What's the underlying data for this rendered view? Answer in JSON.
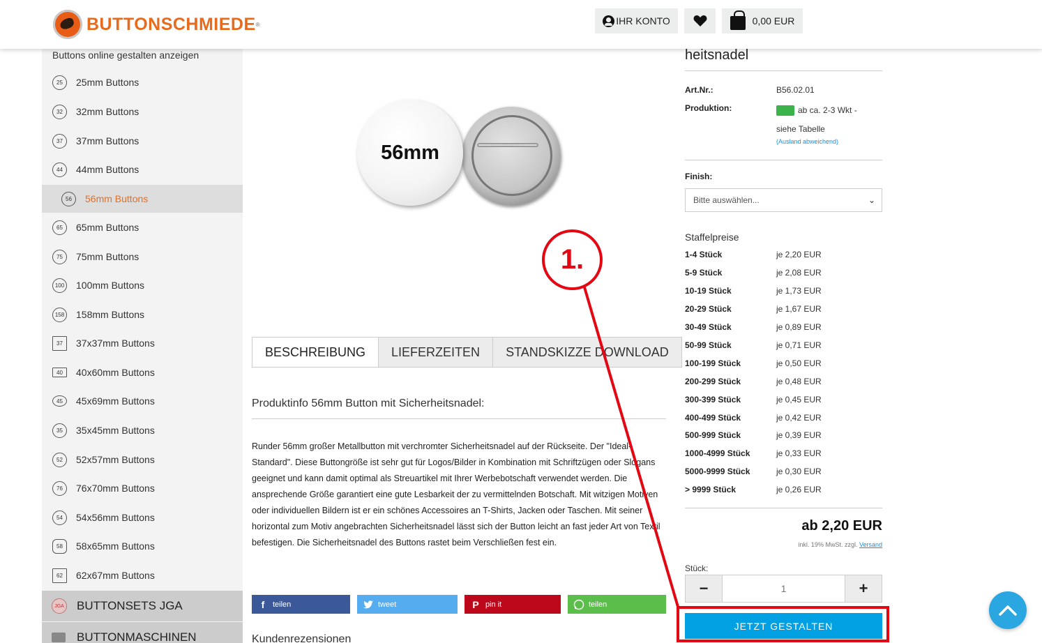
{
  "header": {
    "logo_text": "BUTTONSCHMIEDE",
    "account_label": "IHR KONTO",
    "cart_total": "0,00 EUR"
  },
  "sidebar": {
    "heading": "Buttons online gestalten anzeigen",
    "items": [
      {
        "badge": "25",
        "label": "25mm Buttons"
      },
      {
        "badge": "32",
        "label": "32mm Buttons"
      },
      {
        "badge": "37",
        "label": "37mm Buttons"
      },
      {
        "badge": "44",
        "label": "44mm Buttons"
      },
      {
        "badge": "56",
        "label": "56mm Buttons"
      },
      {
        "badge": "65",
        "label": "65mm Buttons"
      },
      {
        "badge": "75",
        "label": "75mm Buttons"
      },
      {
        "badge": "100",
        "label": "100mm Buttons"
      },
      {
        "badge": "158",
        "label": "158mm Buttons"
      },
      {
        "badge": "37",
        "label": "37x37mm Buttons"
      },
      {
        "badge": "40",
        "label": "40x60mm Buttons"
      },
      {
        "badge": "45",
        "label": "45x69mm Buttons"
      },
      {
        "badge": "35",
        "label": "35x45mm Buttons"
      },
      {
        "badge": "52",
        "label": "52x57mm Buttons"
      },
      {
        "badge": "76",
        "label": "76x70mm Buttons"
      },
      {
        "badge": "54",
        "label": "54x56mm Buttons"
      },
      {
        "badge": "58",
        "label": "58x65mm Buttons"
      },
      {
        "badge": "62",
        "label": "62x67mm Buttons"
      }
    ],
    "sets_label": "BUTTONSETS JGA",
    "sets_badge": "JGA",
    "machines_label": "BUTTONMASCHINEN"
  },
  "product": {
    "image_label": "56mm",
    "title_partial": "heitsnadel",
    "art_label": "Art.Nr.:",
    "art_value": "B56.02.01",
    "production_label": "Produktion:",
    "production_value": "ab ca. 2-3 Wkt -",
    "production_value2": "siehe Tabelle",
    "production_note": "(Ausland abweichend)",
    "finish_label": "Finish:",
    "finish_placeholder": "Bitte auswählen...",
    "staffel_heading": "Staffelpreise",
    "tiers": [
      {
        "qty": "1-4 Stück",
        "price": "je 2,20 EUR"
      },
      {
        "qty": "5-9 Stück",
        "price": "je 2,08 EUR"
      },
      {
        "qty": "10-19 Stück",
        "price": "je 1,73 EUR"
      },
      {
        "qty": "20-29 Stück",
        "price": "je 1,67 EUR"
      },
      {
        "qty": "30-49 Stück",
        "price": "je 0,89 EUR"
      },
      {
        "qty": "50-99 Stück",
        "price": "je 0,71 EUR"
      },
      {
        "qty": "100-199 Stück",
        "price": "je 0,50 EUR"
      },
      {
        "qty": "200-299 Stück",
        "price": "je 0,48 EUR"
      },
      {
        "qty": "300-399 Stück",
        "price": "je 0,45 EUR"
      },
      {
        "qty": "400-499 Stück",
        "price": "je 0,42 EUR"
      },
      {
        "qty": "500-999 Stück",
        "price": "je 0,39 EUR"
      },
      {
        "qty": "1000-4999 Stück",
        "price": "je 0,33 EUR"
      },
      {
        "qty": "5000-9999 Stück",
        "price": "je 0,30 EUR"
      },
      {
        "qty": "> 9999 Stück",
        "price": "je 0,26 EUR"
      }
    ],
    "price": "ab 2,20 EUR",
    "tax_note": "inkl. 19% MwSt. zzgl.",
    "shipping_link": "Versand",
    "qty_label": "Stück:",
    "qty_minus": "−",
    "qty_value": "1",
    "qty_plus": "+",
    "cta_label": "JETZT GESTALTEN"
  },
  "tabs": [
    "BESCHREIBUNG",
    "LIEFERZEITEN",
    "STANDSKIZZE DOWNLOAD"
  ],
  "description": {
    "heading": "Produktinfo 56mm Button mit Sicherheitsnadel:",
    "text": "Runder 56mm großer Metallbutton mit verchromter Sicherheitsnadel auf der Rückseite. Der \"Ideal-Standard\". Diese Buttongröße ist sehr gut für Logos/Bilder in Kombination mit Schriftzügen oder Slogans geeignet und kann damit optimal als Streuartikel mit Ihrer Werbebotschaft verwendet werden. Die ansprechende Größe garantiert eine gute Lesbarkeit der zu vermittelnden Botschaft. Mit witzigen Motiven oder individuellen Bildern ist er ein schönes Accessoires an T-Shirts, Jacken oder Taschen. Mit seiner horizontal zum Motiv angebrachten Sicherheitsnadel lässt sich der Button leicht an fast jeder Art von Textil befestigen. Die Sicherheitsnadel des Buttons rastet beim Verschließen fest ein."
  },
  "share": {
    "facebook": "teilen",
    "twitter": "tweet",
    "pinterest": "pin it",
    "whatsapp": "teilen"
  },
  "reviews_heading": "Kundenrezensionen",
  "annotation": {
    "label": "1.",
    "color": "#e30613"
  },
  "colors": {
    "accent": "#e96d23",
    "cta": "#00a0e3",
    "annotation": "#e30613"
  }
}
